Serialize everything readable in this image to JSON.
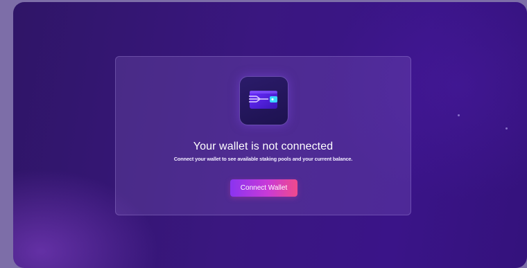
{
  "empty_state": {
    "icon": "wallet-icon",
    "title": "Your wallet is not connected",
    "message": "Connect your wallet to see available staking pools and your current balance.",
    "button_label": "Connect Wallet"
  },
  "colors": {
    "background": "#3a1780",
    "accent_start": "#8a34f0",
    "accent_end": "#f04a8c"
  }
}
